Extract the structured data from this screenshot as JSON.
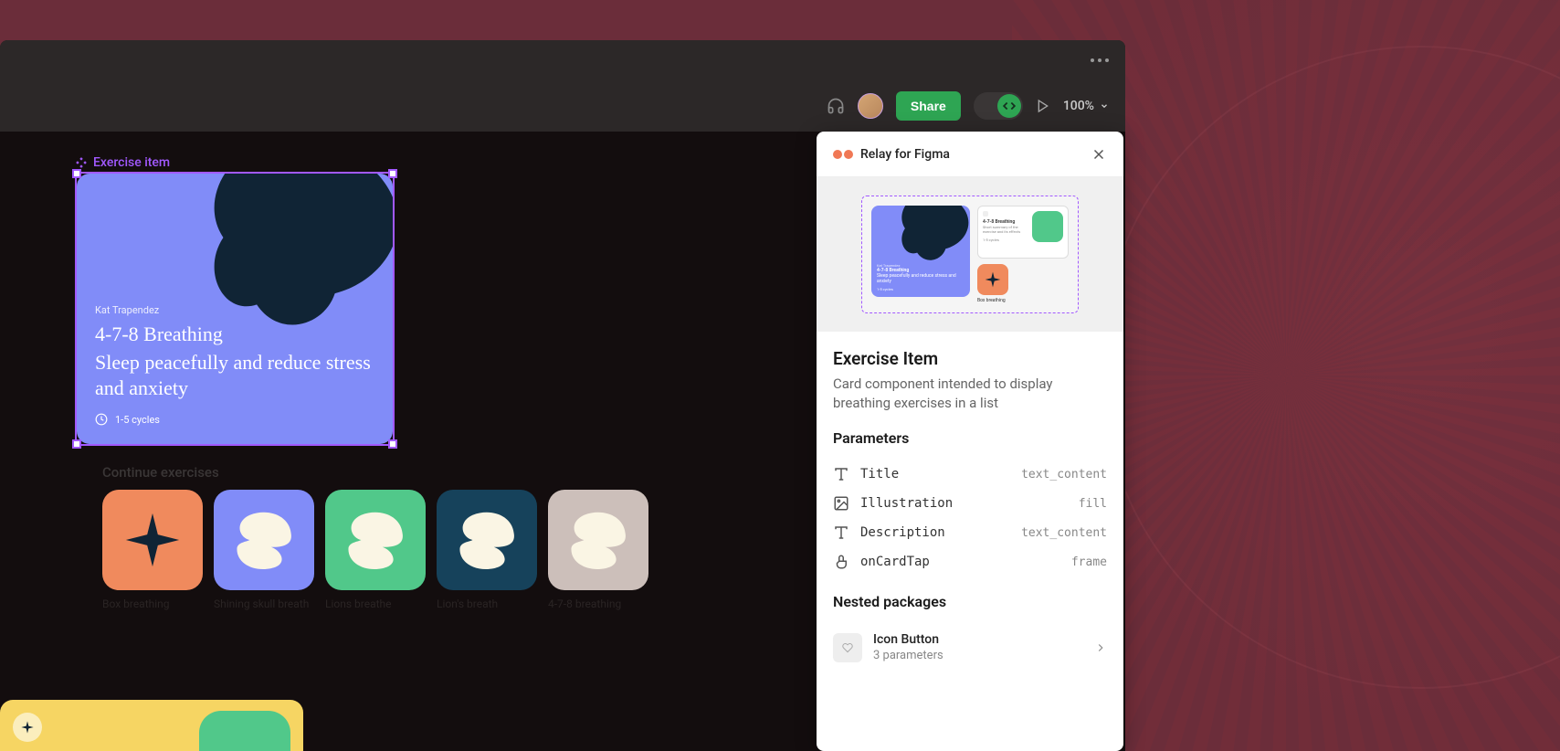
{
  "toolbar": {
    "share_label": "Share",
    "zoom": "100%"
  },
  "selection": {
    "label": "Exercise item"
  },
  "card": {
    "author": "Kat Trapendez",
    "title": "4-7-8 Breathing",
    "description": "Sleep peacefully and reduce stress and anxiety",
    "cycles": "1-5 cycles"
  },
  "continue": {
    "heading": "Continue exercises",
    "items": [
      {
        "label": "Box breathing",
        "bg": "#f08a5d",
        "shape": "sparkle",
        "fg": "#102435"
      },
      {
        "label": "Shining skull breath",
        "bg": "#818cf8",
        "shape": "blob",
        "fg": "#faf5e4"
      },
      {
        "label": "Lions breathe",
        "bg": "#51c88a",
        "shape": "blob",
        "fg": "#faf5e4"
      },
      {
        "label": "Lion's breath",
        "bg": "#16425b",
        "shape": "blob",
        "fg": "#faf5e4"
      },
      {
        "label": "4-7-8 breathing",
        "bg": "#ccbfba",
        "shape": "blob",
        "fg": "#faf5e4"
      }
    ]
  },
  "relay": {
    "plugin_name": "Relay for Figma",
    "preview": {
      "card_title": "4-7-8 Breathing",
      "card_desc": "Sleep peacefully and reduce stress and anxiety",
      "card_author": "Kat Trapendez",
      "card_cycles": "1-5 cycles",
      "detail_title": "4-7-8 Breathing",
      "detail_desc": "Short summary of the exercise and its effects",
      "detail_cycles": "1-5 cycles",
      "small_label": "Box breathing"
    },
    "detail": {
      "title": "Exercise Item",
      "description": "Card component intended to display breathing exercises in a list"
    },
    "parameters_heading": "Parameters",
    "parameters": [
      {
        "name": "Title",
        "type": "text_content",
        "icon": "text"
      },
      {
        "name": "Illustration",
        "type": "fill",
        "icon": "image"
      },
      {
        "name": "Description",
        "type": "text_content",
        "icon": "text"
      },
      {
        "name": "onCardTap",
        "type": "frame",
        "icon": "tap"
      }
    ],
    "nested_heading": "Nested packages",
    "nested": {
      "name": "Icon Button",
      "sub": "3 parameters"
    }
  }
}
